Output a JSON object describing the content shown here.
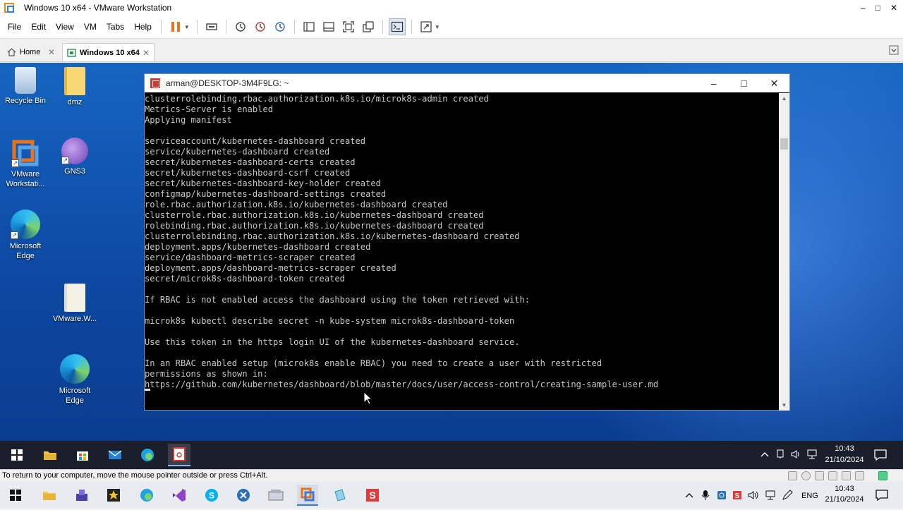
{
  "host": {
    "window_title": "Windows 10 x64 - VMware Workstation",
    "menu": [
      "File",
      "Edit",
      "View",
      "VM",
      "Tabs",
      "Help"
    ],
    "tabs": [
      {
        "label": "Home",
        "icon": "home-icon"
      },
      {
        "label": "Windows 10 x64",
        "icon": "vm-icon",
        "active": true
      }
    ],
    "status_message": "To return to your computer, move the mouse pointer outside or press Ctrl+Alt.",
    "taskbar": {
      "language": "ENG",
      "time": "10:43",
      "date": "21/10/2024"
    }
  },
  "guest": {
    "desktop_icons": [
      {
        "label": "Recycle Bin",
        "icon": "recycle-bin-icon"
      },
      {
        "label": "dmz",
        "icon": "folder-icon"
      },
      {
        "label": "VMware Workstati...",
        "icon": "vmware-workstation-icon"
      },
      {
        "label": "GNS3",
        "icon": "gns3-icon"
      },
      {
        "label": "Microsoft Edge",
        "icon": "edge-icon"
      },
      {
        "label": "VMware.W...",
        "icon": "folder-icon"
      },
      {
        "label": "Microsoft Edge",
        "icon": "edge-icon"
      }
    ],
    "terminal": {
      "title": "arman@DESKTOP-3M4F9LG: ~",
      "lines": [
        "clusterrolebinding.rbac.authorization.k8s.io/microk8s-admin created",
        "Metrics-Server is enabled",
        "Applying manifest",
        "",
        "serviceaccount/kubernetes-dashboard created",
        "service/kubernetes-dashboard created",
        "secret/kubernetes-dashboard-certs created",
        "secret/kubernetes-dashboard-csrf created",
        "secret/kubernetes-dashboard-key-holder created",
        "configmap/kubernetes-dashboard-settings created",
        "role.rbac.authorization.k8s.io/kubernetes-dashboard created",
        "clusterrole.rbac.authorization.k8s.io/kubernetes-dashboard created",
        "rolebinding.rbac.authorization.k8s.io/kubernetes-dashboard created",
        "clusterrolebinding.rbac.authorization.k8s.io/kubernetes-dashboard created",
        "deployment.apps/kubernetes-dashboard created",
        "service/dashboard-metrics-scraper created",
        "deployment.apps/dashboard-metrics-scraper created",
        "secret/microk8s-dashboard-token created",
        "",
        "If RBAC is not enabled access the dashboard using the token retrieved with:",
        "",
        "microk8s kubectl describe secret -n kube-system microk8s-dashboard-token",
        "",
        "Use this token in the https login UI of the kubernetes-dashboard service.",
        "",
        "In an RBAC enabled setup (microk8s enable RBAC) you need to create a user with restricted",
        "permissions as shown in:",
        "https://github.com/kubernetes/dashboard/blob/master/docs/user/access-control/creating-sample-user.md"
      ]
    },
    "taskbar": {
      "time": "10:43",
      "date": "21/10/2024"
    }
  },
  "colors": {
    "desktop_blue": "#1565c0",
    "terminal_bg": "#000000",
    "terminal_text": "#c8c8c8",
    "vmware_orange": "#e8731a"
  }
}
